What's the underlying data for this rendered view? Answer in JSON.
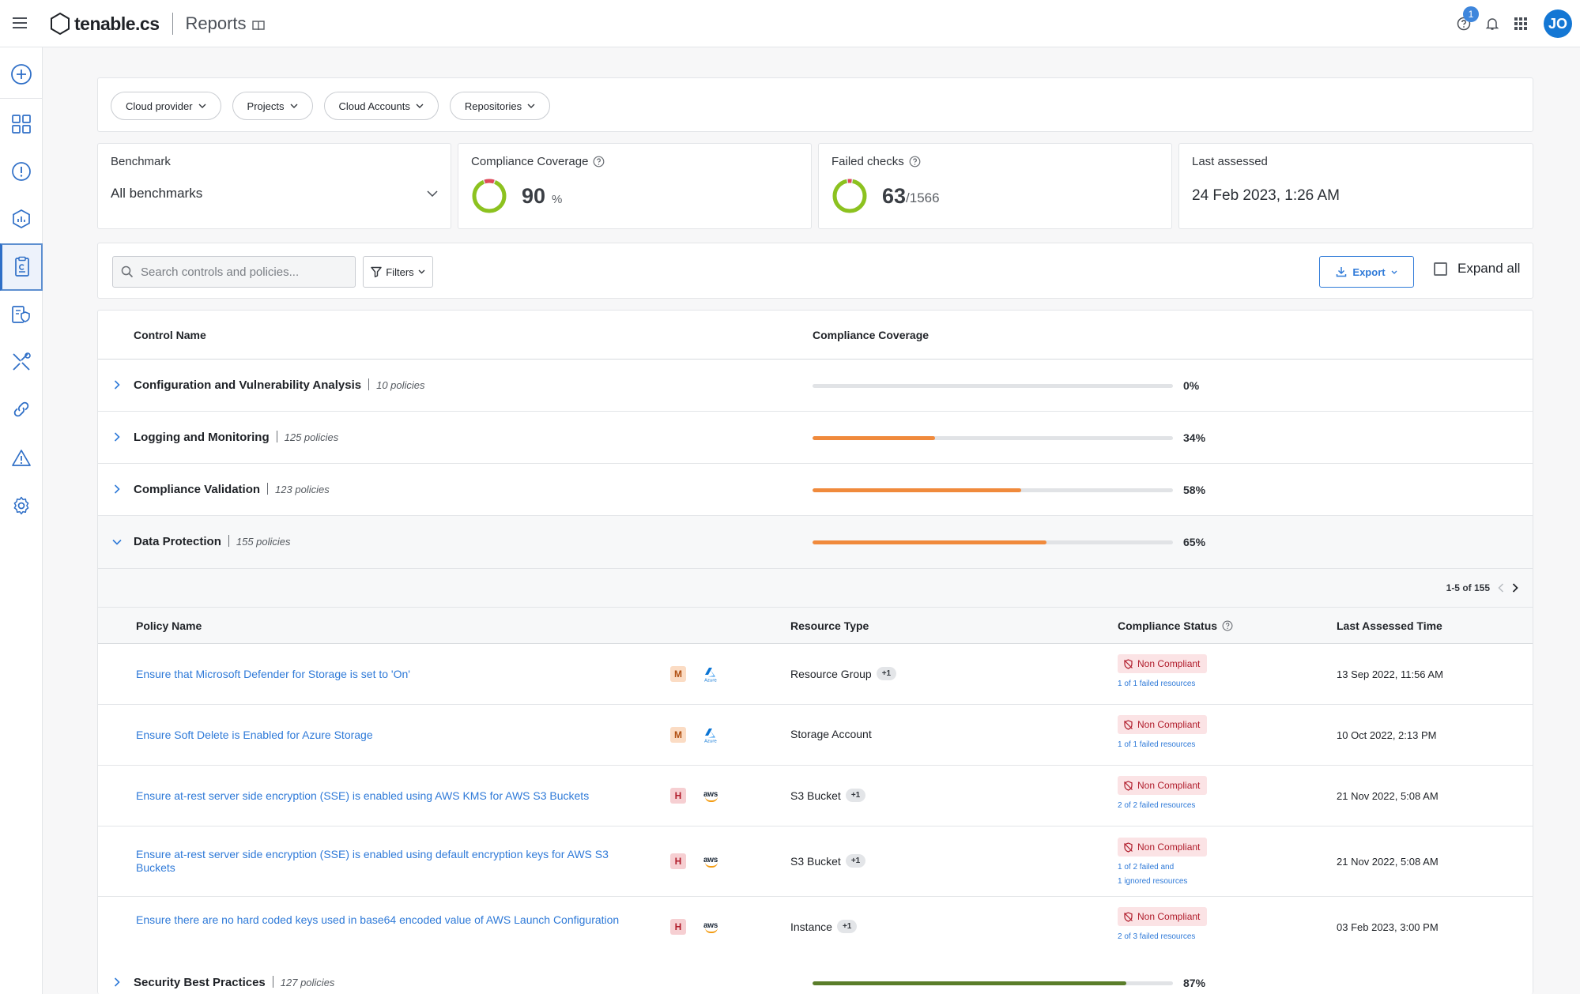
{
  "header": {
    "logo_text": "tenable.cs",
    "page_name": "Reports",
    "help_badge": "1",
    "avatar_initials": "JO"
  },
  "filters": [
    {
      "label": "Cloud provider"
    },
    {
      "label": "Projects"
    },
    {
      "label": "Cloud Accounts"
    },
    {
      "label": "Repositories"
    }
  ],
  "metrics": {
    "benchmark_label": "Benchmark",
    "benchmark_value": "All benchmarks",
    "coverage_label": "Compliance Coverage",
    "coverage_value": "90",
    "coverage_unit": "%",
    "failed_label": "Failed checks",
    "failed_value": "63",
    "failed_total": "/1566",
    "failed_fraction": 0.04,
    "coverage_fraction": 0.9,
    "assessed_label": "Last assessed",
    "assessed_value": "24 Feb 2023, 1:26 AM"
  },
  "toolbar": {
    "search_placeholder": "Search controls and policies...",
    "filters_label": "Filters",
    "export_label": "Export",
    "expand_all_label": "Expand all"
  },
  "table": {
    "col_control_name": "Control Name",
    "col_coverage": "Compliance Coverage",
    "controls": [
      {
        "name": "Configuration and Vulnerability Analysis",
        "policies": "10 policies",
        "percent": "0%",
        "value": 0
      },
      {
        "name": "Logging and Monitoring",
        "policies": "125 policies",
        "percent": "34%",
        "value": 34
      },
      {
        "name": "Compliance Validation",
        "policies": "123 policies",
        "percent": "58%",
        "value": 58
      },
      {
        "name": "Data Protection",
        "policies": "155 policies",
        "percent": "65%",
        "value": 65
      },
      {
        "name": "Security Best Practices",
        "policies": "127 policies",
        "percent": "87%",
        "value": 87
      }
    ]
  },
  "sub_table": {
    "pager": "1-5 of 155",
    "col_policy": "Policy Name",
    "col_resource": "Resource Type",
    "col_status": "Compliance Status",
    "col_time": "Last Assessed Time",
    "rows": [
      {
        "name": "Ensure that Microsoft Defender for Storage is set to 'On'",
        "severity": "M",
        "provider": "Azure",
        "resource": "Resource Group",
        "extra": "+1",
        "status": "Non Compliant",
        "detail": "1 of 1 failed resources",
        "time": "13 Sep 2022, 11:56 AM"
      },
      {
        "name": "Ensure Soft Delete is Enabled for Azure Storage",
        "severity": "M",
        "provider": "Azure",
        "resource": "Storage Account",
        "extra": "",
        "status": "Non Compliant",
        "detail": "1 of 1 failed resources",
        "time": "10 Oct 2022, 2:13 PM"
      },
      {
        "name": "Ensure at-rest server side encryption (SSE) is enabled using AWS KMS for AWS S3 Buckets",
        "severity": "H",
        "provider": "aws",
        "resource": "S3 Bucket",
        "extra": "+1",
        "status": "Non Compliant",
        "detail": "2 of 2 failed resources",
        "time": "21 Nov 2022, 5:08 AM"
      },
      {
        "name": "Ensure at-rest server side encryption (SSE) is enabled using default encryption keys for AWS S3 Buckets",
        "severity": "H",
        "provider": "aws",
        "resource": "S3 Bucket",
        "extra": "+1",
        "status": "Non Compliant",
        "detail": "1 of 2 failed and",
        "detail2": "1 ignored resources",
        "time": "21 Nov 2022, 5:08 AM"
      },
      {
        "name": "Ensure there are no hard coded keys used in base64 encoded value of AWS Launch Configuration",
        "severity": "H",
        "provider": "aws",
        "resource": "Instance",
        "extra": "+1",
        "status": "Non Compliant",
        "detail": "2 of 3 failed resources",
        "time": "03 Feb 2023, 3:00 PM"
      }
    ]
  },
  "colors": {
    "accent": "#2f7ad8",
    "bar_orange": "#f08a3c",
    "bar_green": "#5a7d2a",
    "gauge_green": "#8cc21f",
    "gauge_red": "#e04a5a"
  }
}
